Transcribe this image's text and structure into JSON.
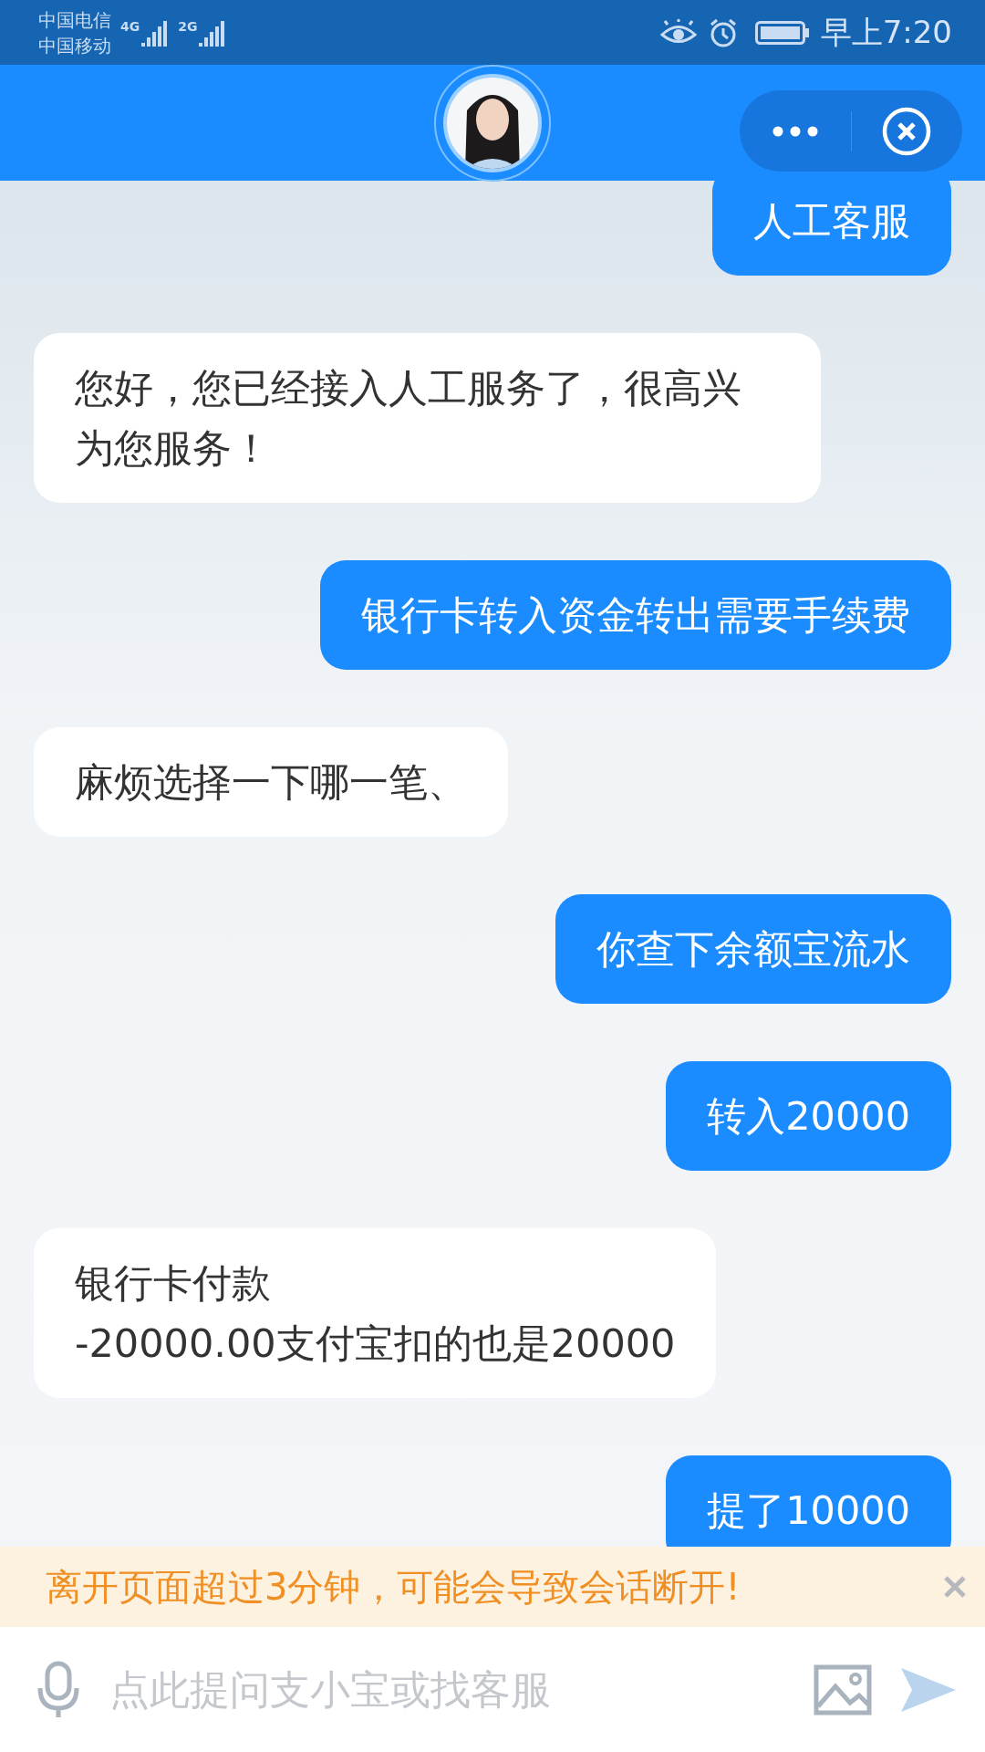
{
  "status_bar": {
    "carriers": [
      "中国电信",
      "中国移动"
    ],
    "networks": [
      "4G",
      "2G"
    ],
    "time": "早上7:20"
  },
  "messages": [
    {
      "kind": "sent",
      "text": "人工客服"
    },
    {
      "kind": "received",
      "text": "您好，您已经接入人工服务了，很高兴为您服务！"
    },
    {
      "kind": "sent",
      "text": "银行卡转入资金转出需要手续费"
    },
    {
      "kind": "received",
      "text": "麻烦选择一下哪一笔、"
    },
    {
      "kind": "sent",
      "text": "你查下余额宝流水"
    },
    {
      "kind": "sent",
      "text": "转入20000"
    },
    {
      "kind": "received",
      "text": "银行卡付款\n-20000.00支付宝扣的也是20000"
    },
    {
      "kind": "sent",
      "text": "提了10000"
    }
  ],
  "notice": {
    "text": "离开页面超过3分钟，可能会导致会话断开!"
  },
  "input": {
    "placeholder": "点此提问支小宝或找客服"
  }
}
